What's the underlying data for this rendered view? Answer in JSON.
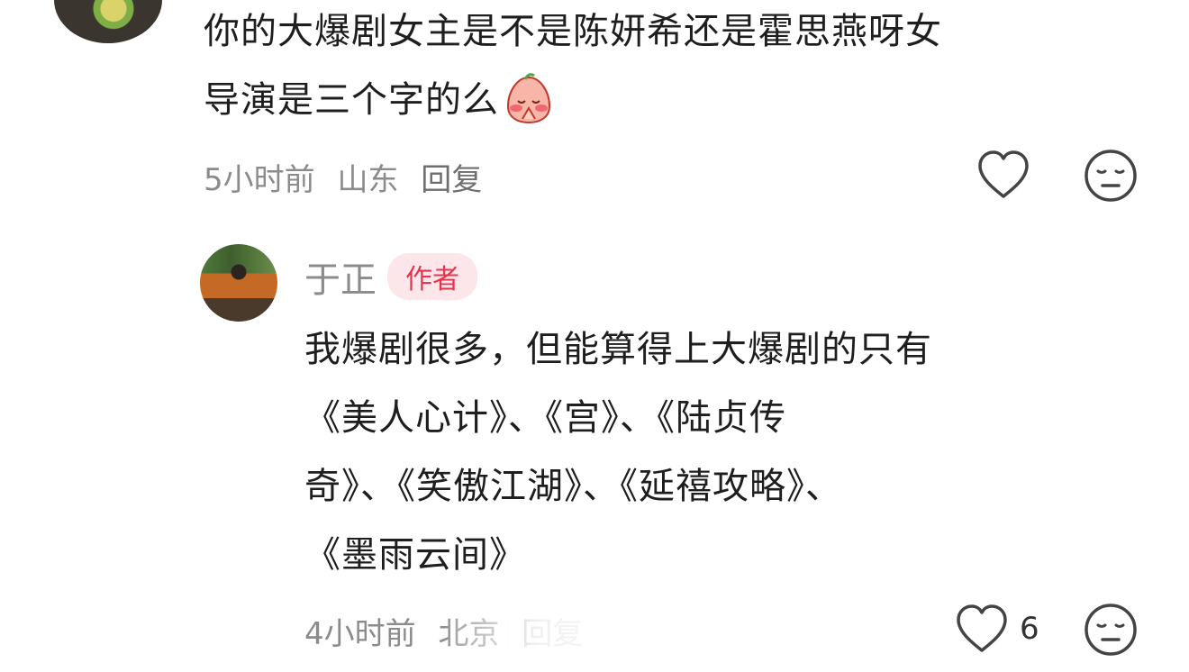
{
  "parent_comment": {
    "text_line1": "你的大爆剧女主是不是陈妍希还是霍思燕呀女",
    "text_line2": "导演是三个字的么",
    "emoji": "praying-blush-emoji",
    "time": "5小时前",
    "location": "山东",
    "reply_label": "回复"
  },
  "reply_comment": {
    "author": "于正",
    "badge": "作者",
    "lines": [
      "我爆剧很多，但能算得上大爆剧的只有",
      "《美人心计》、《宫》、《陆贞传",
      "奇》、《笑傲江湖》、《延禧攻略》、",
      "《墨雨云间》"
    ],
    "time": "4小时前",
    "location": "北京",
    "reply_label": "回复",
    "like_count": "6"
  },
  "colors": {
    "badge_text": "#e8334f",
    "badge_bg": "#fde6ea",
    "meta_text": "#8b8b8b"
  }
}
